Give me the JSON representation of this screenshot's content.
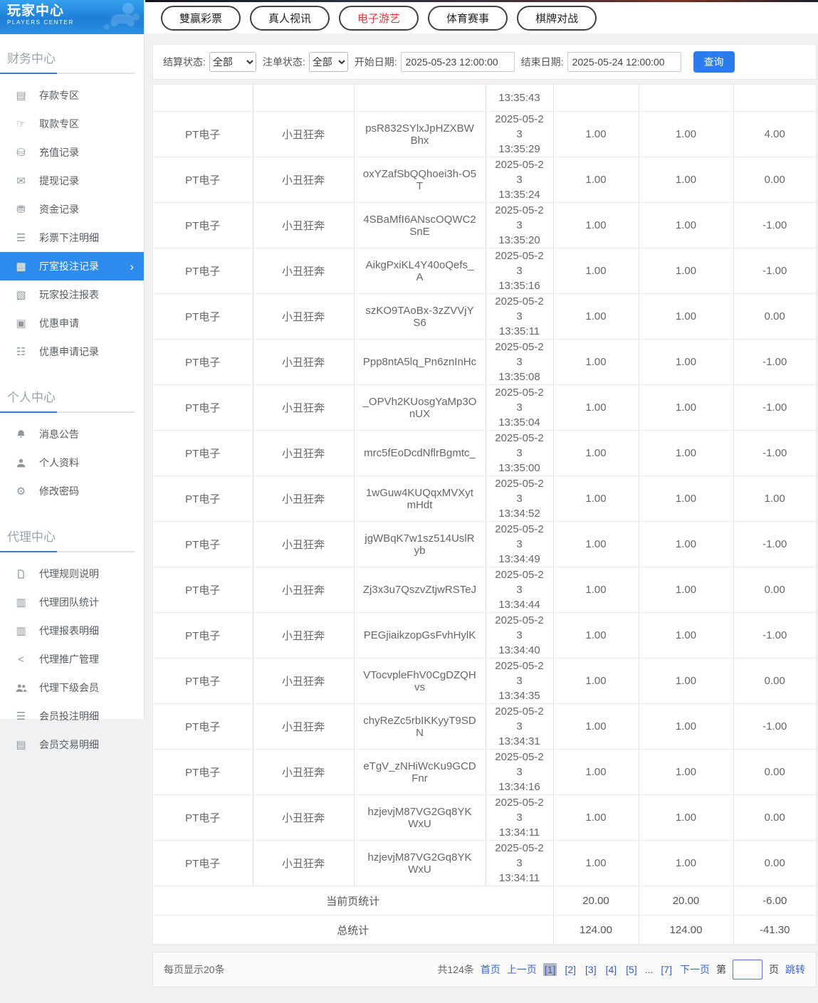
{
  "logo": {
    "title": "玩家中心",
    "subtitle": "PLAYERS CENTER"
  },
  "sidebar": {
    "sections": [
      {
        "heading": "财务中心",
        "items": [
          {
            "key": "deposit-zone",
            "icon": "bank-card-icon",
            "glyph": "▤",
            "label": "存款专区"
          },
          {
            "key": "withdraw-zone",
            "icon": "withdraw-hand-icon",
            "glyph": "☞",
            "label": "取款专区"
          },
          {
            "key": "recharge-records",
            "icon": "coins-icon",
            "glyph": "⛁",
            "label": "充值记录"
          },
          {
            "key": "withdraw-records",
            "icon": "envelope-money-icon",
            "glyph": "✉",
            "label": "提现记录"
          },
          {
            "key": "funds-records",
            "icon": "wallet-icon",
            "glyph": "⛃",
            "label": "资金记录"
          },
          {
            "key": "lottery-bet-details",
            "icon": "list-icon",
            "glyph": "☰",
            "label": "彩票下注明细"
          },
          {
            "key": "hall-bet-records",
            "icon": "grid-list-icon",
            "glyph": "▦",
            "label": "厅室投注记录",
            "active": true,
            "arrow": "›"
          },
          {
            "key": "player-bet-report",
            "icon": "report-chart-icon",
            "glyph": "▧",
            "label": "玩家投注报表"
          },
          {
            "key": "promo-apply",
            "icon": "coupon-icon",
            "glyph": "▣",
            "label": "优惠申请"
          },
          {
            "key": "promo-apply-records",
            "icon": "lines-icon",
            "glyph": "☷",
            "label": "优惠申请记录"
          }
        ]
      },
      {
        "heading": "个人中心",
        "items": [
          {
            "key": "messages",
            "icon": "bell-icon",
            "svg": true,
            "label": "消息公告"
          },
          {
            "key": "profile",
            "icon": "person-icon",
            "svg": true,
            "label": "个人资料"
          },
          {
            "key": "change-password",
            "icon": "gear-icon",
            "glyph": "⚙",
            "label": "修改密码"
          }
        ]
      },
      {
        "heading": "代理中心",
        "items": [
          {
            "key": "agent-rules",
            "icon": "document-icon",
            "svg": true,
            "label": "代理规则说明"
          },
          {
            "key": "agent-team-stats",
            "icon": "report-icon",
            "glyph": "▥",
            "label": "代理团队统计"
          },
          {
            "key": "agent-report-details",
            "icon": "report-icon",
            "glyph": "▥",
            "label": "代理报表明细"
          },
          {
            "key": "agent-promotion",
            "icon": "share-icon",
            "glyph": "<",
            "label": "代理推广管理"
          },
          {
            "key": "agent-sub-members",
            "icon": "users-icon",
            "svg": true,
            "label": "代理下级会员"
          },
          {
            "key": "member-bet-details",
            "icon": "list-icon",
            "glyph": "☰",
            "label": "会员投注明细"
          },
          {
            "key": "member-trade-details",
            "icon": "ledger-icon",
            "glyph": "▤",
            "label": "会员交易明细"
          }
        ]
      }
    ]
  },
  "tabs": [
    {
      "key": "lottery",
      "label": "雙贏彩票",
      "active": false
    },
    {
      "key": "live",
      "label": "真人视讯",
      "active": false
    },
    {
      "key": "electronic",
      "label": "电子游艺",
      "active": true
    },
    {
      "key": "sports",
      "label": "体育赛事",
      "active": false
    },
    {
      "key": "board",
      "label": "棋牌对战",
      "active": false
    }
  ],
  "filters": {
    "settle_label": "结算状态:",
    "settle_value": "全部",
    "order_label": "注单状态:",
    "order_value": "全部",
    "start_label": "开始日期:",
    "start_value": "2025-05-23 12:00:00",
    "end_label": "结束日期:",
    "end_value": "2025-05-24 12:00:00",
    "search_label": "查询"
  },
  "table": {
    "partial_row_time": "13:35:43",
    "rows": [
      {
        "hall": "PT电子",
        "game": "小丑狂奔",
        "order": "psR832SYlxJpHZXBWBhx",
        "date": "2025-05-23",
        "time": "13:35:29",
        "bet": "1.00",
        "valid": "1.00",
        "profit": "4.00"
      },
      {
        "hall": "PT电子",
        "game": "小丑狂奔",
        "order": "oxYZafSbQQhoei3h-O5T",
        "date": "2025-05-23",
        "time": "13:35:24",
        "bet": "1.00",
        "valid": "1.00",
        "profit": "0.00"
      },
      {
        "hall": "PT电子",
        "game": "小丑狂奔",
        "order": "4SBaMfI6ANscOQWC2SnE",
        "date": "2025-05-23",
        "time": "13:35:20",
        "bet": "1.00",
        "valid": "1.00",
        "profit": "-1.00"
      },
      {
        "hall": "PT电子",
        "game": "小丑狂奔",
        "order": "AikgPxiKL4Y40oQefs_A",
        "date": "2025-05-23",
        "time": "13:35:16",
        "bet": "1.00",
        "valid": "1.00",
        "profit": "-1.00"
      },
      {
        "hall": "PT电子",
        "game": "小丑狂奔",
        "order": "szKO9TAoBx-3zZVVjYS6",
        "date": "2025-05-23",
        "time": "13:35:11",
        "bet": "1.00",
        "valid": "1.00",
        "profit": "0.00"
      },
      {
        "hall": "PT电子",
        "game": "小丑狂奔",
        "order": "Ppp8ntA5lq_Pn6znInHc",
        "date": "2025-05-23",
        "time": "13:35:08",
        "bet": "1.00",
        "valid": "1.00",
        "profit": "-1.00"
      },
      {
        "hall": "PT电子",
        "game": "小丑狂奔",
        "order": "_OPVh2KUosgYaMp3OnUX",
        "date": "2025-05-23",
        "time": "13:35:04",
        "bet": "1.00",
        "valid": "1.00",
        "profit": "-1.00"
      },
      {
        "hall": "PT电子",
        "game": "小丑狂奔",
        "order": "mrc5fEoDcdNflrBgmtc_",
        "date": "2025-05-23",
        "time": "13:35:00",
        "bet": "1.00",
        "valid": "1.00",
        "profit": "-1.00"
      },
      {
        "hall": "PT电子",
        "game": "小丑狂奔",
        "order": "1wGuw4KUQqxMVXytmHdt",
        "date": "2025-05-23",
        "time": "13:34:52",
        "bet": "1.00",
        "valid": "1.00",
        "profit": "1.00"
      },
      {
        "hall": "PT电子",
        "game": "小丑狂奔",
        "order": "jgWBqK7w1sz514UslRyb",
        "date": "2025-05-23",
        "time": "13:34:49",
        "bet": "1.00",
        "valid": "1.00",
        "profit": "-1.00"
      },
      {
        "hall": "PT电子",
        "game": "小丑狂奔",
        "order": "Zj3x3u7QszvZtjwRSTeJ",
        "date": "2025-05-23",
        "time": "13:34:44",
        "bet": "1.00",
        "valid": "1.00",
        "profit": "0.00"
      },
      {
        "hall": "PT电子",
        "game": "小丑狂奔",
        "order": "PEGjiaikzopGsFvhHylK",
        "date": "2025-05-23",
        "time": "13:34:40",
        "bet": "1.00",
        "valid": "1.00",
        "profit": "-1.00"
      },
      {
        "hall": "PT电子",
        "game": "小丑狂奔",
        "order": "VTocvpleFhV0CgDZQHvs",
        "date": "2025-05-23",
        "time": "13:34:35",
        "bet": "1.00",
        "valid": "1.00",
        "profit": "0.00"
      },
      {
        "hall": "PT电子",
        "game": "小丑狂奔",
        "order": "chyReZc5rbIKKyyT9SDN",
        "date": "2025-05-23",
        "time": "13:34:31",
        "bet": "1.00",
        "valid": "1.00",
        "profit": "-1.00"
      },
      {
        "hall": "PT电子",
        "game": "小丑狂奔",
        "order": "eTgV_zNHiWcKu9GCDFnr",
        "date": "2025-05-23",
        "time": "13:34:16",
        "bet": "1.00",
        "valid": "1.00",
        "profit": "0.00"
      },
      {
        "hall": "PT电子",
        "game": "小丑狂奔",
        "order": "hzjevjM87VG2Gq8YKWxU",
        "date": "2025-05-23",
        "time": "13:34:11",
        "bet": "1.00",
        "valid": "1.00",
        "profit": "0.00"
      },
      {
        "hall": "PT电子",
        "game": "小丑狂奔",
        "order": "hzjevjM87VG2Gq8YKWxU",
        "date": "2025-05-23",
        "time": "13:34:11",
        "bet": "1.00",
        "valid": "1.00",
        "profit": "0.00"
      }
    ],
    "page_stats": {
      "label": "当前页统计",
      "bet": "20.00",
      "valid": "20.00",
      "profit": "-6.00"
    },
    "total_stats": {
      "label": "总统计",
      "bet": "124.00",
      "valid": "124.00",
      "profit": "-41.30"
    }
  },
  "pagination": {
    "per_page": "每页显示20条",
    "total": "共124条",
    "first": "首页",
    "prev": "上一页",
    "pages": [
      {
        "label": "[1]",
        "current": true
      },
      {
        "label": "[2]"
      },
      {
        "label": "[3]"
      },
      {
        "label": "[4]"
      },
      {
        "label": "[5]"
      },
      {
        "label": "...",
        "ellipsis": true
      },
      {
        "label": "[7]"
      }
    ],
    "next": "下一页",
    "jump_prefix": "第",
    "jump_suffix": "页",
    "jump_label": "跳转"
  },
  "colors": {
    "sidebar_active_blue": "#2b8ced",
    "heading_accent_blue": "#2b7fd8",
    "tab_active_red": "#e4393c",
    "query_button_blue": "#2b7cee",
    "link_blue": "#3968cf",
    "table_divider_pink": "#f1d9d9"
  }
}
